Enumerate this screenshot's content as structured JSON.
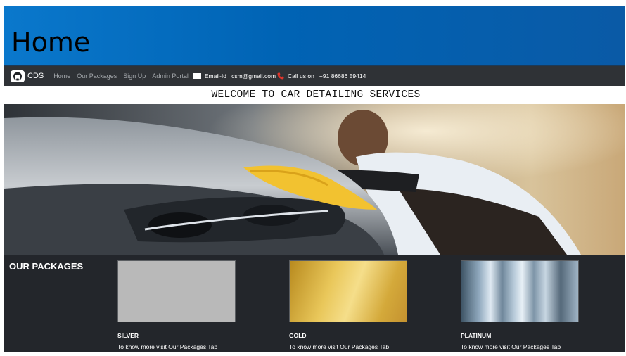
{
  "page": {
    "title": "Home"
  },
  "navbar": {
    "brand": "CDS",
    "links": [
      "Home",
      "Our Packages",
      "Sign Up",
      "Admin Portal"
    ],
    "email": "Email-Id : csm@gmail.com",
    "phone": "Call us on : +91 86686 59414"
  },
  "welcome": "WELCOME TO CAR DETAILING SERVICES",
  "hero": {
    "description": "photo of a person polishing a car headlight with a yellow microfiber cloth"
  },
  "packages": {
    "heading": "OUR PACKAGES",
    "items": [
      {
        "name": "SILVER",
        "note": "To know more visit Our Packages Tab",
        "color": "#b9b9b9"
      },
      {
        "name": "GOLD",
        "note": "To know more visit Our Packages Tab",
        "color": "#d9b447"
      },
      {
        "name": "PLATINUM",
        "note": "To know more visit Our Packages Tab",
        "color": "#7f97ad"
      }
    ]
  },
  "colors": {
    "banner": "#0063b4",
    "navbar": "#2f3236",
    "packages_bg": "#23262b"
  }
}
